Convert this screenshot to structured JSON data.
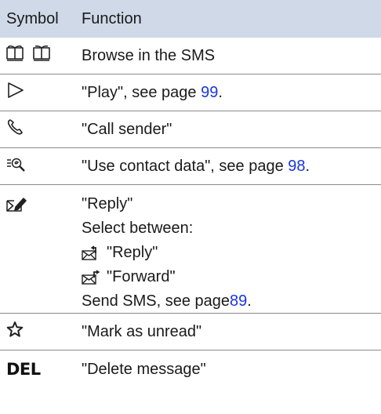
{
  "header": {
    "symbol": "Symbol",
    "function": "Function"
  },
  "rows": {
    "browse": {
      "icon": "browse-pages-icon",
      "text": "Browse in the SMS"
    },
    "play": {
      "icon": "play-triangle-icon",
      "text": "\"Play\", see page ",
      "page": "99",
      "end": "."
    },
    "call": {
      "icon": "phone-handset-icon",
      "text": "\"Call sender\""
    },
    "contact": {
      "icon": "contact-search-icon",
      "text": "\"Use contact data\", see page ",
      "page": "98",
      "end": "."
    },
    "reply": {
      "icon": "compose-pen-icon",
      "line1": "\"Reply\"",
      "line2": "Select between:",
      "opt1_icon": "reply-envelope-icon",
      "opt1": "\"Reply\"",
      "opt2_icon": "forward-envelope-icon",
      "opt2": "\"Forward\"",
      "line5": "Send SMS, see page ",
      "page": "89",
      "end": "."
    },
    "unread": {
      "icon": "star-outline-icon",
      "text": "\"Mark as unread\""
    },
    "delete": {
      "icon": "DEL",
      "text": "\"Delete message\""
    }
  },
  "colors": {
    "header_bg": "#cfd9e8",
    "link": "#1a35e0",
    "divider": "#8a8a8a"
  }
}
